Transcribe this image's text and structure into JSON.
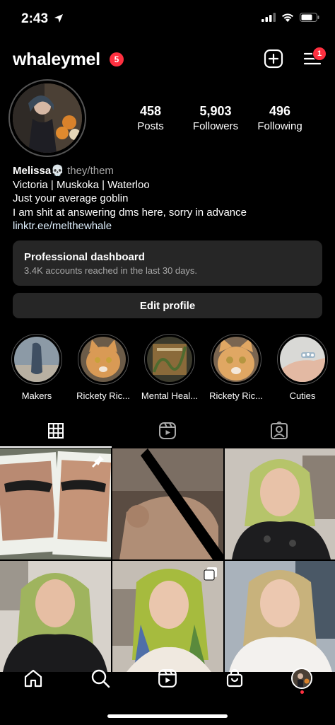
{
  "status_bar": {
    "time": "2:43"
  },
  "header": {
    "username": "whaleymel",
    "notification_count": "5",
    "menu_badge_count": "1"
  },
  "profile": {
    "stats": [
      {
        "value": "458",
        "label": "Posts"
      },
      {
        "value": "5,903",
        "label": "Followers"
      },
      {
        "value": "496",
        "label": "Following"
      }
    ],
    "bio": {
      "name": "Melissa",
      "emoji": "💀",
      "pronouns": "they/them",
      "lines": [
        "Victoria | Muskoka | Waterloo",
        "Just your average goblin",
        "I am shit at answering dms here, sorry in advance"
      ],
      "link": "linktr.ee/melthewhale"
    }
  },
  "dashboard": {
    "title": "Professional dashboard",
    "subtitle": "3.4K accounts reached in the last 30 days."
  },
  "edit_profile_label": "Edit profile",
  "highlights": [
    {
      "label": "Makers"
    },
    {
      "label": "Rickety Ric..."
    },
    {
      "label": "Mental Heal..."
    },
    {
      "label": "Rickety Ric..."
    },
    {
      "label": "Cuties"
    }
  ],
  "tabs": [
    "grid-icon",
    "reels-icon",
    "tagged-icon"
  ],
  "nav": [
    "home-icon",
    "search-icon",
    "reels-icon",
    "shop-icon",
    "profile-avatar"
  ],
  "colors": {
    "badge": "#ff3040",
    "card": "#262626",
    "muted": "#a8a8a8"
  }
}
